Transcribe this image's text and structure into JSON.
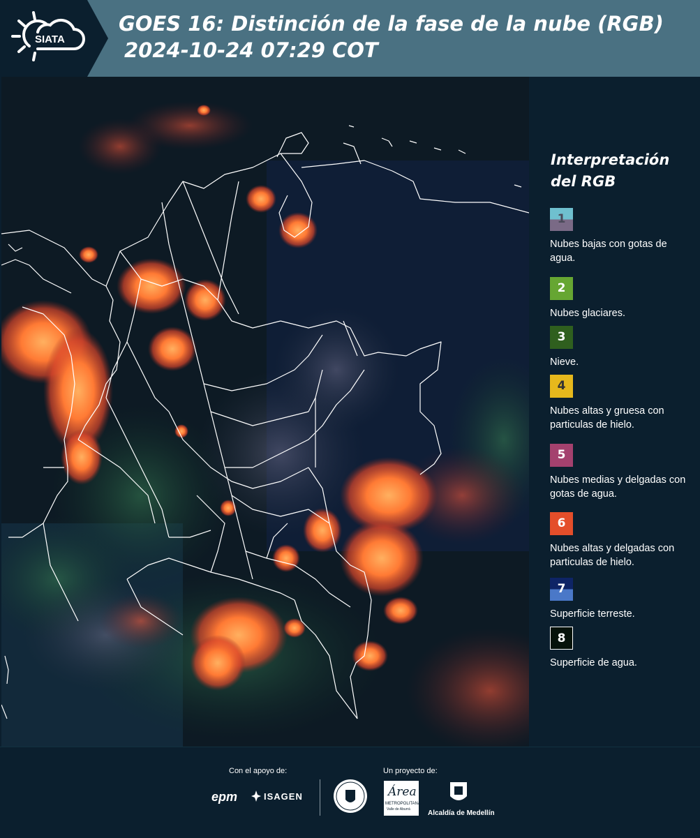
{
  "header": {
    "logo_text": "SIATA",
    "title": "GOES 16: Distinción de la fase de la nube (RGB)",
    "subtitle": "2024-10-24 07:29 COT"
  },
  "legend": {
    "title_line1": "Interpretación",
    "title_line2": "del RGB",
    "items": [
      {
        "number": "1",
        "label": "Nubes bajas con gotas de agua.",
        "color_top": "#6fc0cf",
        "color_bottom": "#7a6a86",
        "text_color": "#4a4a5a"
      },
      {
        "number": "2",
        "label": "Nubes glaciares.",
        "color_top": "#66a632",
        "color_bottom": "#66a632",
        "text_color": "#ffffff"
      },
      {
        "number": "3",
        "label": "Nieve.",
        "color_top": "#2f5f1e",
        "color_bottom": "#2f5f1e",
        "text_color": "#ffffff"
      },
      {
        "number": "4",
        "label": "Nubes altas y gruesa con particulas de hielo.",
        "color_top": "#e6b81c",
        "color_bottom": "#e6b81c",
        "text_color": "#333333"
      },
      {
        "number": "5",
        "label": "Nubes medias y delgadas con gotas de agua.",
        "color_top": "#a4416e",
        "color_bottom": "#a4416e",
        "text_color": "#ffffff"
      },
      {
        "number": "6",
        "label": "Nubes altas y delgadas con particulas de hielo.",
        "color_top": "#e44e2a",
        "color_bottom": "#e44e2a",
        "text_color": "#ffffff"
      },
      {
        "number": "7",
        "label": "Superficie terreste.",
        "color_top": "#0e2466",
        "color_bottom": "#4a78c8",
        "text_color": "#ffffff"
      },
      {
        "number": "8",
        "label": "Superficie de agua.",
        "color_top": "#06120a",
        "color_bottom": "#06120a",
        "text_color": "#ffffff"
      }
    ]
  },
  "footer": {
    "support_label": "Con el apoyo de:",
    "project_label": "Un proyecto de:",
    "sponsor_epm": "epm",
    "sponsor_isagen": "ISAGEN",
    "area_logo_text": "Área",
    "area_sub_text": "METROPOLITANA",
    "area_sub_text2": "Valle de Aburrá",
    "alcaldia_text": "Alcaldía de Medellín"
  },
  "colors": {
    "header_bg": "#4a7182",
    "panel_bg": "#0b1f2e",
    "cloud_orange": "#ff6a2a",
    "border_white": "#ffffff"
  }
}
